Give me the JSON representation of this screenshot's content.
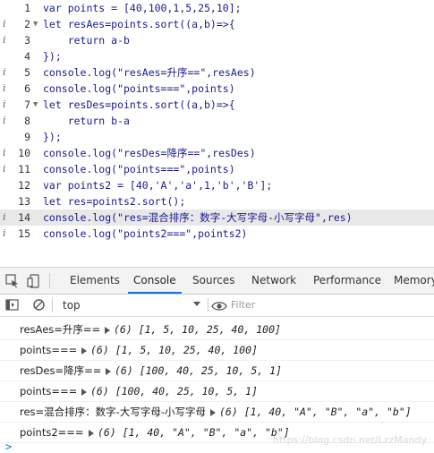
{
  "editor": {
    "lines": [
      {
        "num": "1",
        "info": "",
        "fold": "",
        "code": "var points = [40,100,1,5,25,10];"
      },
      {
        "num": "2",
        "info": "i",
        "fold": "▼",
        "code": "let resAes=points.sort((a,b)=>{"
      },
      {
        "num": "3",
        "info": "i",
        "fold": "",
        "code": "    return a-b"
      },
      {
        "num": "4",
        "info": "",
        "fold": "",
        "code": "});"
      },
      {
        "num": "5",
        "info": "i",
        "fold": "",
        "code": "console.log(\"resAes=升序==\",resAes)"
      },
      {
        "num": "6",
        "info": "i",
        "fold": "",
        "code": "console.log(\"points===\",points)"
      },
      {
        "num": "7",
        "info": "i",
        "fold": "▼",
        "code": "let resDes=points.sort((a,b)=>{"
      },
      {
        "num": "8",
        "info": "i",
        "fold": "",
        "code": "    return b-a"
      },
      {
        "num": "9",
        "info": "",
        "fold": "",
        "code": "});"
      },
      {
        "num": "10",
        "info": "i",
        "fold": "",
        "code": "console.log(\"resDes=降序==\",resDes)"
      },
      {
        "num": "11",
        "info": "i",
        "fold": "",
        "code": "console.log(\"points===\",points)"
      },
      {
        "num": "12",
        "info": "",
        "fold": "",
        "code": "var points2 = [40,'A','a',1,'b','B'];"
      },
      {
        "num": "13",
        "info": "",
        "fold": "",
        "code": "let res=points2.sort();"
      },
      {
        "num": "14",
        "info": "i",
        "fold": "",
        "code": "console.log(\"res=混合排序：数字-大写字母-小写字母\",res)"
      },
      {
        "num": "15",
        "info": "i",
        "fold": "",
        "code": "console.log(\"points2===\",points2)"
      }
    ],
    "highlight_line": "14"
  },
  "tabs": [
    "Elements",
    "Console",
    "Sources",
    "Network",
    "Performance",
    "Memory"
  ],
  "active_tab": "Console",
  "toolbar": {
    "context": "top",
    "filter_placeholder": "Filter"
  },
  "console": [
    {
      "label": "resAes=升序==",
      "summary": "(6) [1, 5, 10, 25, 40, 100]"
    },
    {
      "label": "points===",
      "summary": "(6) [1, 5, 10, 25, 40, 100]"
    },
    {
      "label": "resDes=降序==",
      "summary": "(6) [100, 40, 25, 10, 5, 1]"
    },
    {
      "label": "points===",
      "summary": "(6) [100, 40, 25, 10, 5, 1]"
    },
    {
      "label": "res=混合排序：数字-大写字母-小写字母",
      "summary": "(6) [1, 40, \"A\", \"B\", \"a\", \"b\"]"
    },
    {
      "label": "points2===",
      "summary": "(6) [1, 40, \"A\", \"B\", \"a\", \"b\"]"
    }
  ],
  "prompt": ">",
  "watermark": "https://blog.csdn.net/LzzMandy"
}
